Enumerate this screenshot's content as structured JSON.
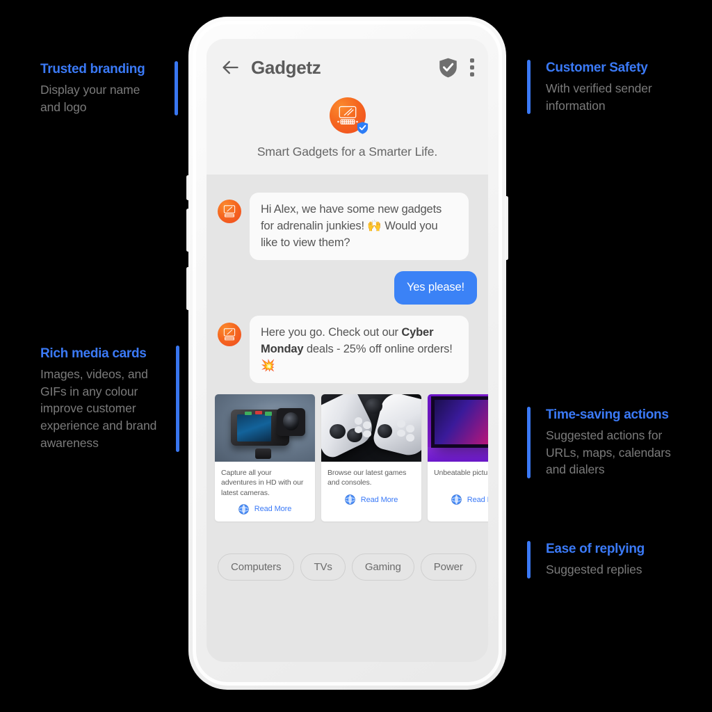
{
  "accent_color": "#3b7af7",
  "callouts": [
    {
      "id": "trusted-branding",
      "title": "Trusted branding",
      "body": "Display your name and logo"
    },
    {
      "id": "rich-media",
      "title": "Rich media cards",
      "body": "Images, videos, and GIFs in any colour improve customer experience and brand awareness"
    },
    {
      "id": "customer-safety",
      "title": "Customer Safety",
      "body": "With verified sender information"
    },
    {
      "id": "time-saving",
      "title": "Time-saving actions",
      "body": "Suggested actions for URLs, maps, calendars and dialers"
    },
    {
      "id": "ease-replying",
      "title": "Ease of replying",
      "body": "Suggested replies"
    }
  ],
  "phone": {
    "header": {
      "back_icon": "arrow-left-icon",
      "title": "Gadgetz",
      "verified_icon": "shield-check-icon",
      "menu_icon": "kebab-menu-icon"
    },
    "brand": {
      "logo_icon": "desktop-computer-logo",
      "verified_badge_icon": "verified-badge-icon",
      "tagline": "Smart Gadgets for a Smarter Life."
    },
    "messages": [
      {
        "direction": "in",
        "avatar_icon": "brand-avatar-icon",
        "text": "Hi Alex, we have some new gadgets for adrenalin junkies! 🙌 Would you like to view them?"
      },
      {
        "direction": "out",
        "text": "Yes please!"
      },
      {
        "direction": "in",
        "avatar_icon": "brand-avatar-icon",
        "text_parts": [
          {
            "t": "Here you go. Check out our ",
            "bold": false
          },
          {
            "t": "Cyber Monday",
            "bold": true
          },
          {
            "t": " deals - 25% off online orders! 💥",
            "bold": false
          }
        ]
      }
    ],
    "cards": [
      {
        "art": "camera",
        "text": "Capture all your adventures in HD with our latest cameras.",
        "action_icon": "globe-icon",
        "action_label": "Read More"
      },
      {
        "art": "gamepads",
        "text": "Browse our latest games and consoles.",
        "action_icon": "globe-icon",
        "action_label": "Read More"
      },
      {
        "art": "tv",
        "text": "Unbeatable picture qualit",
        "action_icon": "globe-icon",
        "action_label": "Read More"
      }
    ],
    "suggested_replies": [
      "Computers",
      "TVs",
      "Gaming",
      "Power"
    ]
  }
}
